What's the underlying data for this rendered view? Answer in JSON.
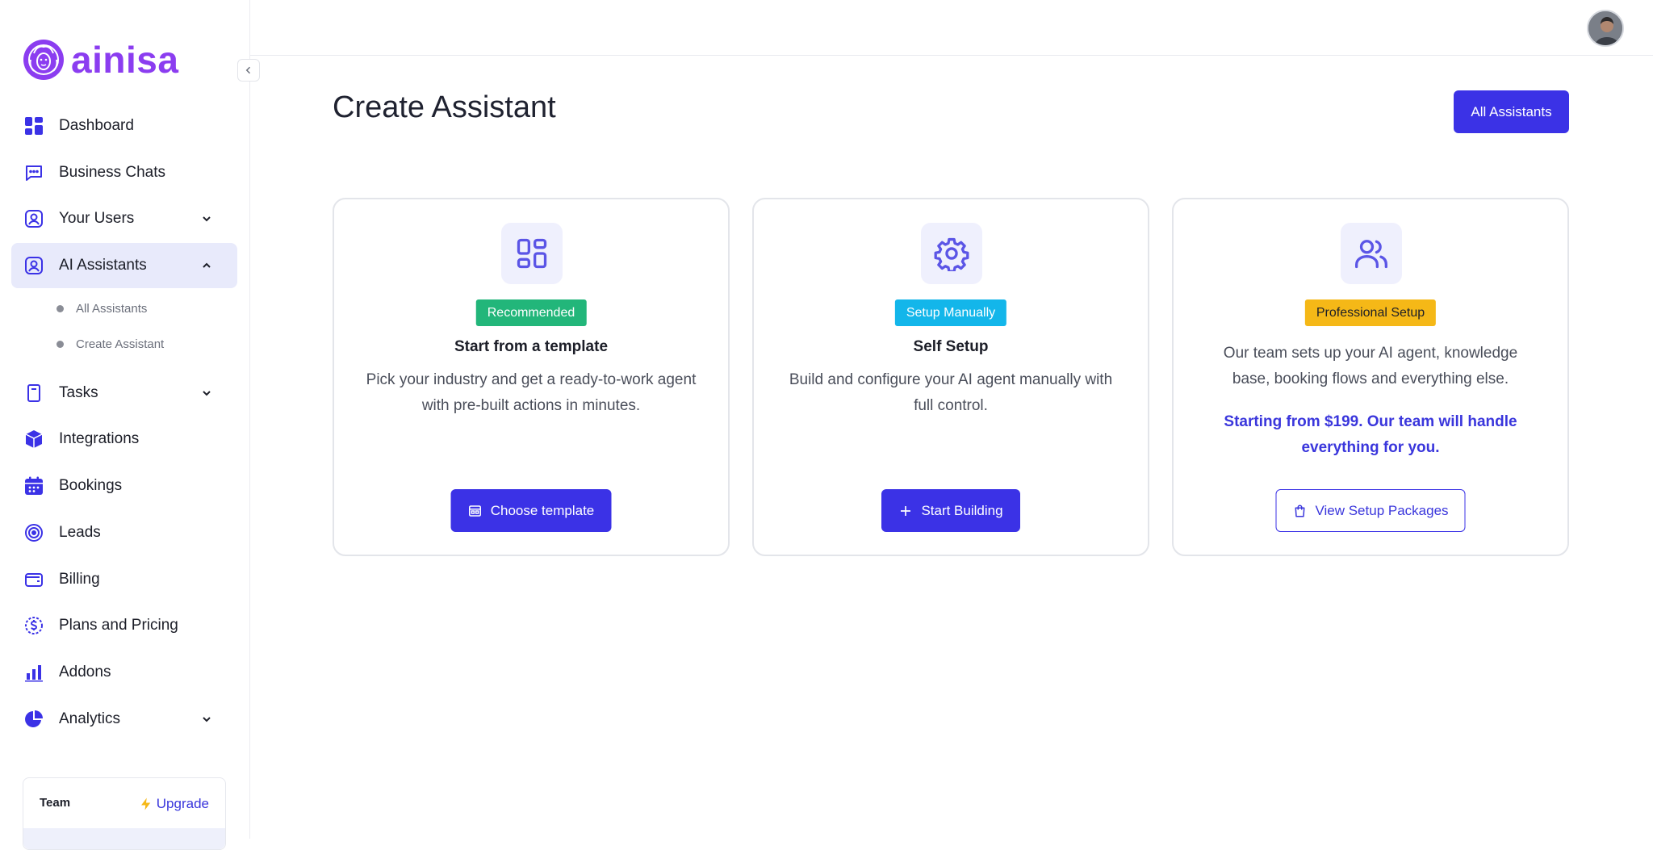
{
  "brand": {
    "name": "ainisa",
    "color": "#8b3df0"
  },
  "sidebar": {
    "items": [
      {
        "label": "Dashboard",
        "icon": "dashboard-icon"
      },
      {
        "label": "Business Chats",
        "icon": "chat-icon"
      },
      {
        "label": "Your Users",
        "icon": "user-icon",
        "expandable": true
      },
      {
        "label": "AI Assistants",
        "icon": "assistant-icon",
        "expandable": true,
        "expanded": true
      },
      {
        "label": "Tasks",
        "icon": "clipboard-icon",
        "expandable": true
      },
      {
        "label": "Integrations",
        "icon": "cube-icon"
      },
      {
        "label": "Bookings",
        "icon": "calendar-icon"
      },
      {
        "label": "Leads",
        "icon": "target-icon"
      },
      {
        "label": "Billing",
        "icon": "wallet-icon"
      },
      {
        "label": "Plans and Pricing",
        "icon": "dollar-icon"
      },
      {
        "label": "Addons",
        "icon": "bar-chart-icon"
      },
      {
        "label": "Analytics",
        "icon": "pie-chart-icon",
        "expandable": true
      }
    ],
    "ai_assistants_sub": [
      {
        "label": "All Assistants"
      },
      {
        "label": "Create Assistant"
      }
    ],
    "team_card": {
      "label": "Team",
      "upgrade_label": "Upgrade"
    }
  },
  "main": {
    "title": "Create Assistant",
    "all_assistants_label": "All Assistants",
    "cards": [
      {
        "icon": "grid-icon",
        "badge": "Recommended",
        "badge_color": "#22b67a",
        "title": "Start from a template",
        "description": "Pick your industry and get a ready-to-work agent with pre-built actions in minutes.",
        "button_label": "Choose template",
        "button_icon": "template-icon"
      },
      {
        "icon": "gear-icon",
        "badge": "Setup Manually",
        "badge_color": "#13b6ea",
        "title": "Self Setup",
        "description": "Build and configure your AI agent manually with full control.",
        "button_label": "Start Building",
        "button_icon": "plus-icon"
      },
      {
        "icon": "users-icon",
        "badge": "Professional Setup",
        "badge_color": "#f5b817",
        "description": "Our team sets up your AI agent, knowledge base, booking flows and everything else.",
        "promo": "Starting from $199. Our team will handle everything for you.",
        "button_label": "View Setup Packages",
        "button_icon": "shopping-bag-icon"
      }
    ]
  },
  "colors": {
    "accent": "#3b32e6",
    "active_bg": "#e8eafb"
  }
}
